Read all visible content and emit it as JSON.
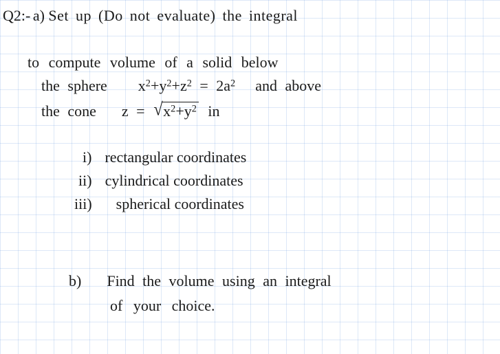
{
  "q_label": "Q2:-",
  "part_a": "a)",
  "line1_rest": "Set up (Do not evaluate) the integral",
  "line2": "to compute volume of a solid below",
  "line3_a": "the sphere",
  "eq_sphere_lhs_x": "x",
  "eq_sphere_lhs_y": "+y",
  "eq_sphere_lhs_z": "+z",
  "eq_sphere_rhs": "= 2a",
  "line3_b": "and above",
  "line4_a": "the cone",
  "eq_cone_lhs": "z =",
  "eq_cone_body_x": "x",
  "eq_cone_body_y": "+y",
  "line4_b": "in",
  "item_i": "i)",
  "item_i_txt": "rectangular coordinates",
  "item_ii": "ii)",
  "item_ii_txt": "cylindrical coordinates",
  "item_iii": "iii)",
  "item_iii_txt": "spherical coordinates",
  "part_b": "b)",
  "b_line1": "Find the volume using an integral",
  "b_line2": "of your choice."
}
